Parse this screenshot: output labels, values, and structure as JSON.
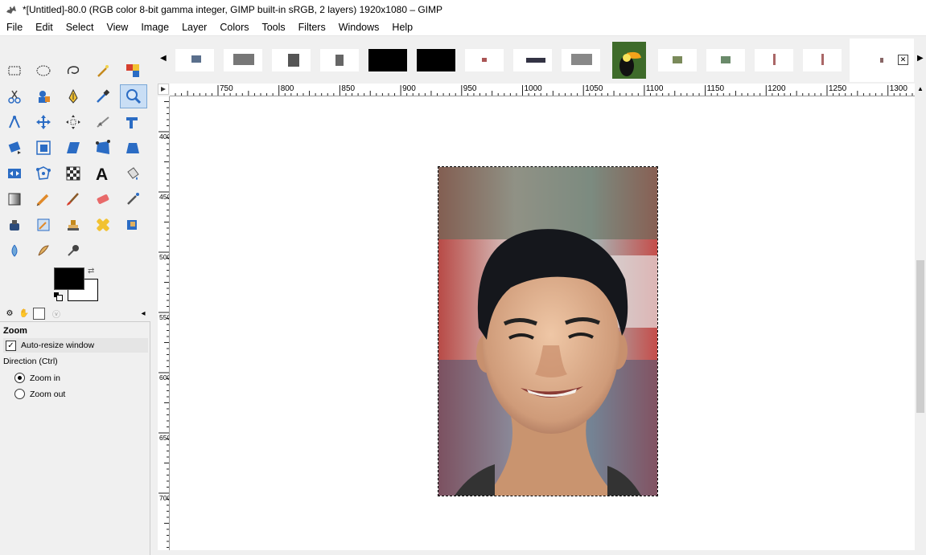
{
  "window": {
    "title": "*[Untitled]-80.0 (RGB color 8-bit gamma integer, GIMP built-in sRGB, 2 layers) 1920x1080 – GIMP"
  },
  "menu": [
    "File",
    "Edit",
    "Select",
    "View",
    "Image",
    "Layer",
    "Colors",
    "Tools",
    "Filters",
    "Windows",
    "Help"
  ],
  "tools": [
    "rect-select",
    "ellipse-select",
    "free-select",
    "fuzzy-select",
    "select-by-color",
    "scissors-select",
    "foreground-select",
    "paths",
    "color-picker",
    "zoom",
    "measure",
    "move",
    "alignment",
    "crop",
    "unified-transform",
    "rotate",
    "scale",
    "shear",
    "perspective",
    "3d-transform",
    "flip",
    "cage-transform",
    "warp-transform",
    "text",
    "bucket-fill",
    "gradient",
    "pencil",
    "paintbrush",
    "eraser",
    "airbrush",
    "ink",
    "mypaint-brush",
    "clone",
    "heal",
    "perspective-clone",
    "blur-sharpen",
    "smudge",
    "dodge-burn"
  ],
  "tool_options": {
    "title": "Zoom",
    "auto_resize_label": "Auto-resize window",
    "auto_resize_checked": true,
    "direction_label": "Direction  (Ctrl)",
    "zoom_in_label": "Zoom in",
    "zoom_out_label": "Zoom out",
    "selected": "Zoom in"
  },
  "ruler": {
    "h_labels": [
      "750",
      "800",
      "850",
      "900",
      "950",
      "1000",
      "1050",
      "1100",
      "1150",
      "1200",
      "1250",
      "1300"
    ],
    "v_labels": [
      "400",
      "450",
      "500",
      "550",
      "600",
      "650",
      "700"
    ]
  },
  "colors": {
    "foreground": "#000000",
    "background": "#ffffff",
    "accent": "#7aa7d6"
  }
}
